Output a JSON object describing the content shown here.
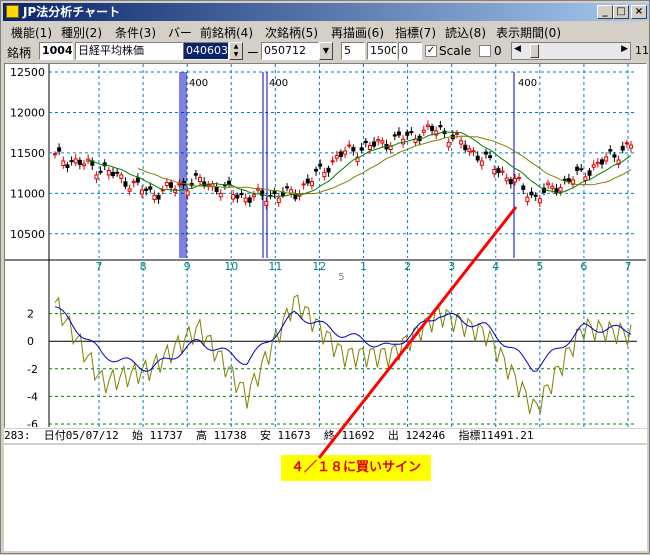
{
  "window": {
    "title": "JP法分析チャート",
    "min": "_",
    "max": "□",
    "close": "×"
  },
  "menu": [
    "機能(1)",
    "種別(2)",
    "条件(3)",
    "バー",
    "前銘柄(4)",
    "次銘柄(5)",
    "再描画(6)",
    "指標(7)",
    "読込(8)",
    "表示期間(0)"
  ],
  "toolbar": {
    "code_label": "銘柄",
    "code": "1004",
    "name": "日経平均株価",
    "date_from": "040603",
    "dash": "ー",
    "date_to": "050712",
    "param1": "5",
    "param2": "1500",
    "param3": "0",
    "scale_label": "Scale",
    "zero_label": "0",
    "right_num": "11"
  },
  "colors": {
    "price_up": "#e00000",
    "price_down": "#000000",
    "ma_short": "#008000",
    "ma_long": "#808000",
    "osc_fast": "#0000c0",
    "osc_slow": "#808000",
    "annotation_line": "#ff0000",
    "annotation_bg": "#ffff00"
  },
  "chart_data": [
    {
      "type": "line",
      "x": [
        "7",
        "8",
        "9",
        "10",
        "11",
        "12",
        "1",
        "2",
        "3",
        "4",
        "5",
        "6",
        "7"
      ],
      "x_sublabel": "5",
      "ylim": [
        10250,
        12500
      ],
      "yticks": [
        "12500",
        "12000",
        "11500",
        "11000",
        "10500"
      ],
      "markers": [
        "400",
        "400",
        "400"
      ],
      "series": [
        {
          "values": [
            11450,
            11300,
            11000,
            11150,
            10950,
            11000,
            11500,
            11650,
            11800,
            11400,
            10950,
            11250,
            11600
          ]
        }
      ]
    },
    {
      "type": "line",
      "ylim": [
        -6,
        4
      ],
      "yticks": [
        "2",
        "0",
        "-2",
        "-4",
        "-6"
      ],
      "series": [
        {
          "values": [
            2.5,
            -1,
            -2,
            0,
            -1.5,
            2,
            0.5,
            -0.5,
            2,
            1,
            -2,
            1,
            0.8
          ]
        },
        {
          "values": [
            2.8,
            -3,
            -2,
            1,
            -4,
            3,
            -1,
            -1,
            2,
            0.5,
            -5,
            1,
            0.5
          ]
        }
      ]
    }
  ],
  "status": "283:  日付05/07/12  始 11737  高 11738  安 11673  終 11692  出 124246  指標11491.21",
  "annotation": "４／１８に買いサイン"
}
